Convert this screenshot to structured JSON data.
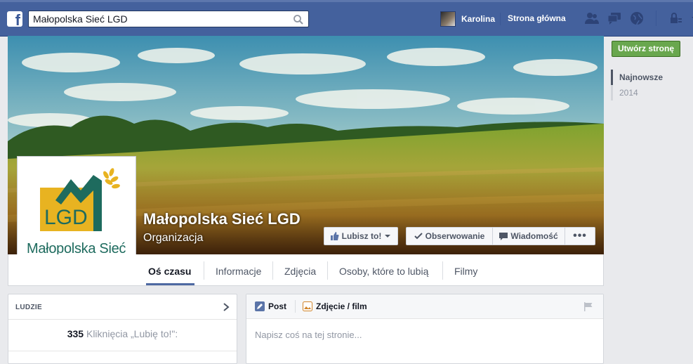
{
  "topbar": {
    "search_value": "Małopolska Sieć LGD",
    "user_name": "Karolina",
    "home_label": "Strona główna"
  },
  "page": {
    "name": "Małopolska Sieć LGD",
    "category": "Organizacja",
    "logo_text": "Małopolska Sieć",
    "logo_mark": "LGD"
  },
  "cover_actions": {
    "like": "Lubisz to!",
    "follow": "Obserwowanie",
    "message": "Wiadomość",
    "more": "•••"
  },
  "tabs": [
    {
      "label": "Oś czasu",
      "active": true
    },
    {
      "label": "Informacje"
    },
    {
      "label": "Zdjęcia"
    },
    {
      "label": "Osoby, które to lubią"
    },
    {
      "label": "Filmy"
    }
  ],
  "sidebar": {
    "create_page": "Utwórz stronę",
    "timeline_years": [
      "Najnowsze",
      "2014"
    ]
  },
  "people": {
    "title": "LUDZIE",
    "likes_count": "335",
    "likes_label": "Kliknięcia „Lubię to!\":"
  },
  "composer": {
    "post_tab": "Post",
    "photo_tab": "Zdjęcie / film",
    "placeholder": "Napisz coś na tej stronie..."
  },
  "colors": {
    "topbar": "#44619d",
    "create_button": "#69a74e",
    "logo_yellow": "#e8b321",
    "logo_teal": "#1e6b5e"
  }
}
